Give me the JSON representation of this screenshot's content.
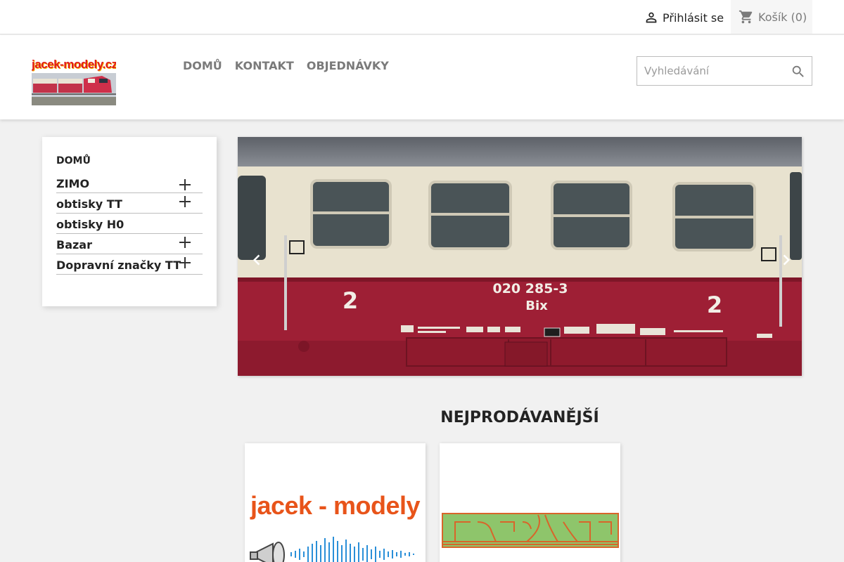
{
  "topbar": {
    "login_label": "Přihlásit se",
    "cart_label": "Košík",
    "cart_count": "(0)"
  },
  "header": {
    "logo_text": "jacek-modely.cz",
    "nav": [
      "DOMŮ",
      "KONTAKT",
      "OBJEDNÁVKY"
    ],
    "search_placeholder": "Vyhledávání"
  },
  "sidebar": {
    "title": "DOMŮ",
    "categories": [
      {
        "label": "ZIMO",
        "expandable": true
      },
      {
        "label": "obtisky TT",
        "expandable": true
      },
      {
        "label": "obtisky H0",
        "expandable": false
      },
      {
        "label": "Bazar",
        "expandable": true
      },
      {
        "label": "Dopravní značky TT",
        "expandable": true
      }
    ]
  },
  "slider": {
    "car_number": "020 285-3",
    "car_type": "Bix",
    "class_mark": "2"
  },
  "bestsellers": {
    "title": "NEJPRODÁVANĚJŠÍ",
    "product1_text": "jacek - modely"
  },
  "colors": {
    "accent": "#232323",
    "wagon_red": "#9e1f35",
    "wagon_cream": "#e8e2cf",
    "logo_red": "#e01a1a"
  },
  "icons": [
    "user-icon",
    "cart-icon",
    "search-icon",
    "plus-icon",
    "chevron-left-icon",
    "chevron-right-icon",
    "megaphone-icon"
  ]
}
